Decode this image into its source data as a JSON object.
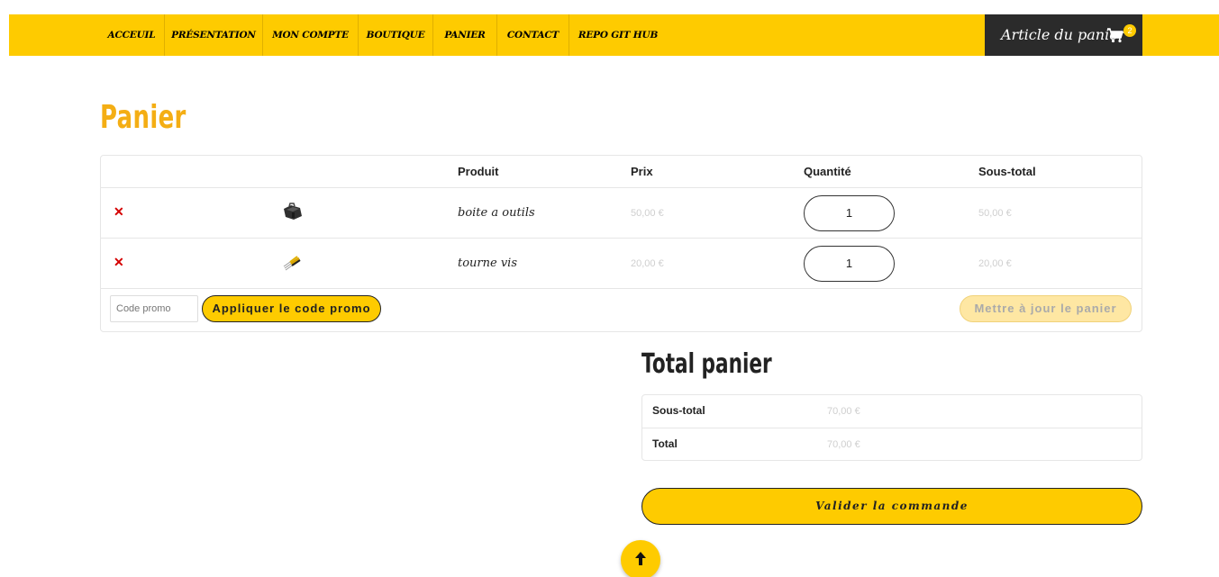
{
  "nav": {
    "items": [
      {
        "label": "ACCEUIL"
      },
      {
        "label": "PRÉSENTATION"
      },
      {
        "label": "MON COMPTE"
      },
      {
        "label": "BOUTIQUE"
      },
      {
        "label": "PANIER"
      },
      {
        "label": "CONTACT"
      },
      {
        "label": "REPO GIT HUB"
      }
    ],
    "cart_label": "Article du panier",
    "cart_count": "2",
    "cart_icon": "shopping-cart-icon"
  },
  "page_title": "Panier",
  "cart": {
    "headers": {
      "product": "Produit",
      "price": "Prix",
      "quantity": "Quantité",
      "subtotal": "Sous-total"
    },
    "rows": [
      {
        "name": "boite a outils",
        "price": "50,00 €",
        "quantity": "1",
        "subtotal": "50,00 €",
        "thumb_icon": "toolbox-image"
      },
      {
        "name": "tourne vis",
        "price": "20,00 €",
        "quantity": "1",
        "subtotal": "20,00 €",
        "thumb_icon": "screwdriver-image"
      }
    ],
    "remove_icon": "close-icon",
    "promo_placeholder": "Code promo",
    "promo_button": "Appliquer le code promo",
    "update_button": "Mettre à jour le panier"
  },
  "totals": {
    "title": "Total panier",
    "subtotal_label": "Sous-total",
    "subtotal_value": "70,00 €",
    "total_label": "Total",
    "total_value": "70,00 €",
    "checkout_button": "Valider la commande"
  },
  "back_to_top_icon": "arrow-up-icon",
  "colors": {
    "accent": "#fecb00",
    "title": "#f4ae14",
    "dark": "#2b2b2b",
    "remove": "#d40000"
  }
}
